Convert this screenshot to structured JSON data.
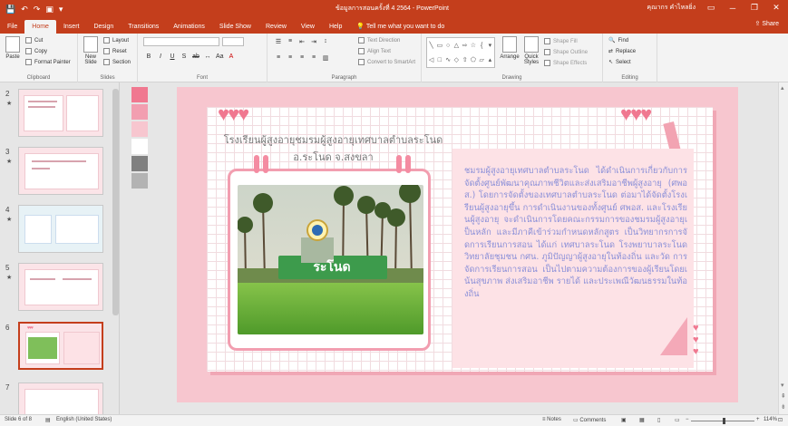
{
  "app": {
    "title": "ข้อมูลการสอนครั้งที่ 4 2564 - PowerPoint",
    "user": "คุณากร คำไหลยิ่ง",
    "window_controls": [
      "▭",
      "─",
      "❐",
      "✕"
    ]
  },
  "tabs": [
    {
      "label": "File"
    },
    {
      "label": "Home",
      "active": true
    },
    {
      "label": "Insert"
    },
    {
      "label": "Design"
    },
    {
      "label": "Transitions"
    },
    {
      "label": "Animations"
    },
    {
      "label": "Slide Show"
    },
    {
      "label": "Review"
    },
    {
      "label": "View"
    },
    {
      "label": "Help"
    }
  ],
  "tell_me": "Tell me what you want to do",
  "share": "Share",
  "ribbon": {
    "clipboard": {
      "paste": "Paste",
      "cut": "Cut",
      "copy": "Copy",
      "format_painter": "Format Painter",
      "label": "Clipboard"
    },
    "slides": {
      "new_slide": "New Slide",
      "layout": "Layout",
      "reset": "Reset",
      "section": "Section",
      "label": "Slides"
    },
    "font": {
      "label": "Font"
    },
    "paragraph": {
      "text_direction": "Text Direction",
      "align_text": "Align Text",
      "convert": "Convert to SmartArt",
      "label": "Paragraph"
    },
    "drawing": {
      "arrange": "Arrange",
      "quick_styles": "Quick Styles",
      "shape_fill": "Shape Fill",
      "shape_outline": "Shape Outline",
      "shape_effects": "Shape Effects",
      "label": "Drawing"
    },
    "editing": {
      "find": "Find",
      "replace": "Replace",
      "select": "Select",
      "label": "Editing"
    }
  },
  "thumbnails": [
    {
      "num": "2"
    },
    {
      "num": "3"
    },
    {
      "num": "4"
    },
    {
      "num": "5"
    },
    {
      "num": "6",
      "selected": true
    },
    {
      "num": "7"
    }
  ],
  "slide": {
    "title_line1": "โรงเรียนผู้สูงอายุชมรมผู้สูงอายุเทศบาลตำบลระโนด",
    "title_line2": "อ.ระโนด จ.สงขลา",
    "photo_sign": "ระโนด",
    "body": "ชมรมผู้สูงอายุเทศบาลตำบลระโนด ได้ดำเนินการเกี่ยวกับการจัดตั้งศูนย์พัฒนาคุณภาพชีวิตและส่งเสริมอาชีพผู้สูงอายุ (ศพอส.) โดยการจัดตั้งของเทศบาลตำบลระโนด ต่อมาได้จัดตั้งโรงเรียนผู้สูงอายุขึ้น การดำเนินงานของทั้งศูนย์ ศพอส. และโรงเรียนผู้สูงอายุ จะดำเนินการโดยคณะกรรมการของชมรมผู้สูงอายุเป็นหลัก และมีภาคีเข้าร่วมกำหนดหลักสูตร เป็นวิทยากรการจัดการเรียนการสอน ได้แก่ เทศบาลระโนด โรงพยาบาลระโนด วิทยาลัยชุมชน กศน. ภูมิปัญญาผู้สูงอายุในท้องถิ่น และวัด การจัดการเรียนการสอน เป็นไปตามความต้องการของผู้เรียนโดยเน้นสุขภาพ ส่งเสริมอาชีพ รายได้ และประเพณีวัฒนธรรมในท้องถิ่น",
    "hearts_left": "♥♥♥",
    "hearts_right": "♥♥♥",
    "hearts_side": "♥♥♥"
  },
  "swatch_colors": [
    "#f07890",
    "#f29eb0",
    "#f7c6cf",
    "#ffffff",
    "#808080",
    "#b3b3b3"
  ],
  "status": {
    "slide_of": "Slide 6 of 8",
    "language": "English (United States)",
    "notes": "Notes",
    "comments": "Comments",
    "zoom": "114%"
  },
  "colors": {
    "accent": "#c43e1c",
    "slide_bg": "#f7c6cf",
    "body_text": "#8a8fd8"
  }
}
